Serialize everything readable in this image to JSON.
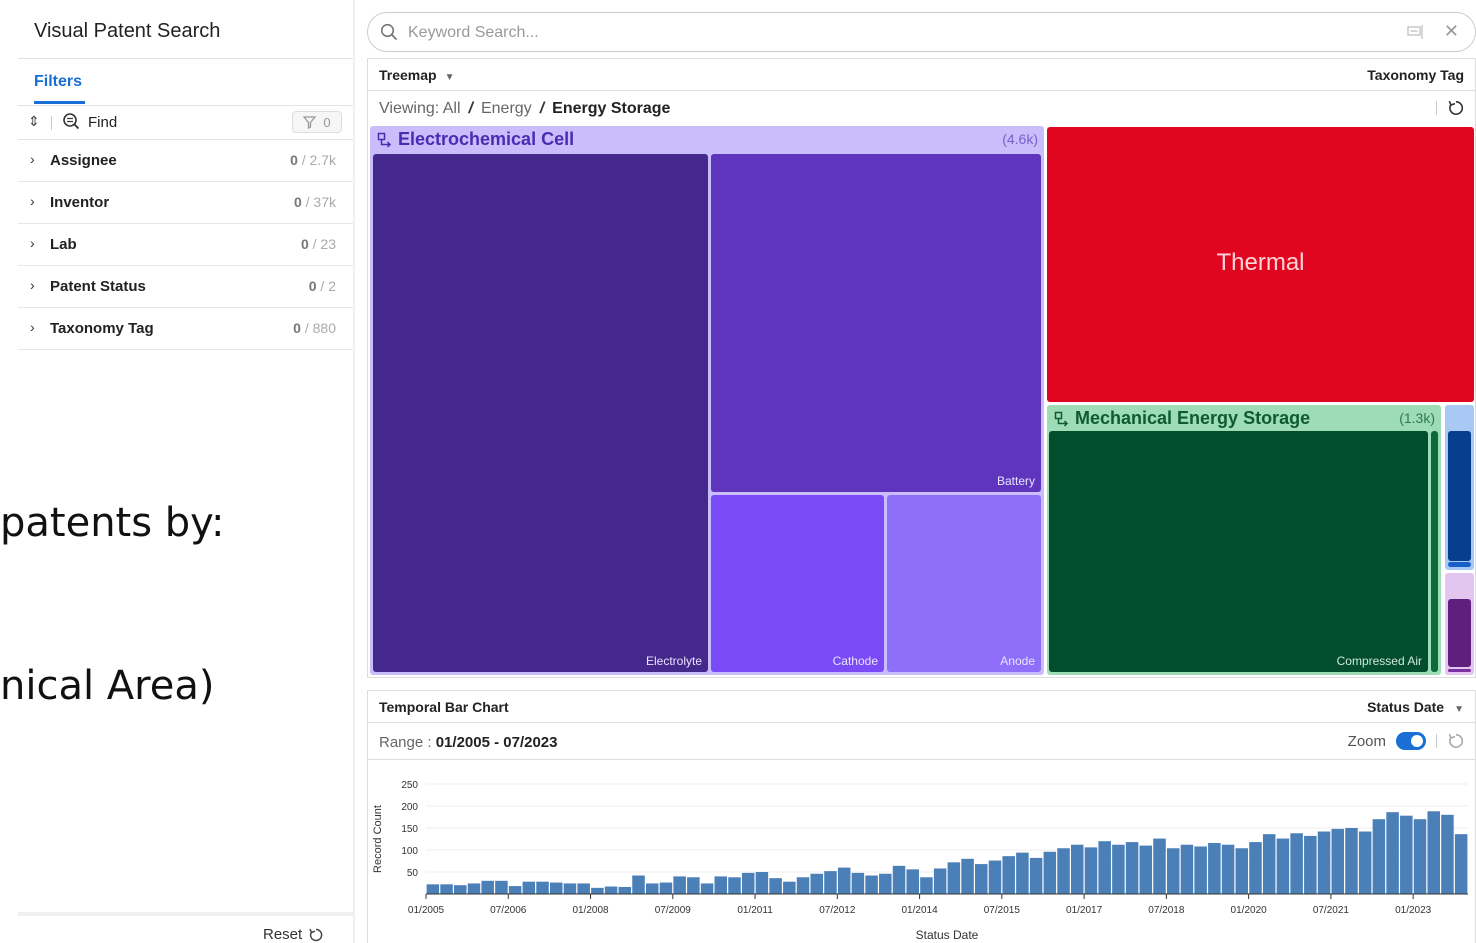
{
  "app": {
    "title": "Visual Patent Search"
  },
  "sidebar": {
    "tab_label": "Filters",
    "find_label": "Find",
    "filter_count": "0",
    "facets": [
      {
        "label": "Assignee",
        "selected": "0",
        "total": "/ 2.7k"
      },
      {
        "label": "Inventor",
        "selected": "0",
        "total": "/ 37k"
      },
      {
        "label": "Lab",
        "selected": "0",
        "total": "/ 23"
      },
      {
        "label": "Patent Status",
        "selected": "0",
        "total": "/ 2"
      },
      {
        "label": "Taxonomy Tag",
        "selected": "0",
        "total": "/ 880"
      }
    ],
    "reset_label": "Reset"
  },
  "overlay": {
    "line1": "patents by:",
    "line2": "nical Area)"
  },
  "search": {
    "placeholder": "Keyword Search...",
    "value": ""
  },
  "treemap_panel": {
    "title": "Treemap",
    "dimension": "Taxonomy Tag",
    "viewing_label": "Viewing:",
    "breadcrumb": [
      "All",
      "Energy",
      "Energy Storage"
    ],
    "groups": {
      "electrochemical": {
        "title": "Electrochemical Cell",
        "count": "(4.6k)"
      },
      "mechanical": {
        "title": "Mechanical Energy Storage",
        "count": "(1.3k)"
      }
    },
    "leaves": {
      "electrolyte": "Electrolyte",
      "battery": "Battery",
      "cathode": "Cathode",
      "anode": "Anode",
      "thermal": "Thermal",
      "compressed_air": "Compressed Air"
    },
    "colors": {
      "electrochemical_header": "#c9bdfc",
      "electrochemical_title": "#4b2bb0",
      "electrolyte": "#44288c",
      "battery": "#5f35bd",
      "cathode": "#7a4af7",
      "anode": "#8f6ff9",
      "thermal": "#e0061f",
      "mechanical_header": "#9ddcb6",
      "mechanical_title": "#0e5a33",
      "compressed_air": "#024e2c"
    }
  },
  "bar_panel": {
    "title": "Temporal Bar Chart",
    "dimension": "Status Date",
    "range_label": "Range :",
    "range_value": "01/2005 - 07/2023",
    "zoom_label": "Zoom",
    "zoom_on": true
  },
  "chart_data": {
    "type": "bar",
    "xlabel": "Status Date",
    "ylabel": "Record Count",
    "ylim": [
      0,
      250
    ],
    "yticks": [
      50,
      100,
      150,
      200,
      250
    ],
    "xticks": [
      "01/2005",
      "07/2006",
      "01/2008",
      "07/2009",
      "01/2011",
      "07/2012",
      "01/2014",
      "07/2015",
      "01/2017",
      "07/2018",
      "01/2020",
      "07/2021",
      "01/2023"
    ],
    "bar_color": "#4a7fb8",
    "bucket": "quarter",
    "start": "01/2005",
    "values": [
      22,
      22,
      20,
      24,
      30,
      30,
      18,
      28,
      28,
      26,
      24,
      24,
      14,
      17,
      16,
      42,
      24,
      26,
      40,
      38,
      24,
      40,
      38,
      48,
      50,
      36,
      28,
      38,
      46,
      52,
      60,
      48,
      42,
      46,
      64,
      56,
      38,
      58,
      72,
      80,
      68,
      76,
      86,
      94,
      82,
      96,
      104,
      112,
      106,
      120,
      112,
      118,
      110,
      126,
      104,
      112,
      108,
      116,
      112,
      104,
      118,
      136,
      126,
      138,
      132,
      142,
      148,
      150,
      142,
      170,
      186,
      178,
      170,
      188,
      180,
      136
    ]
  }
}
